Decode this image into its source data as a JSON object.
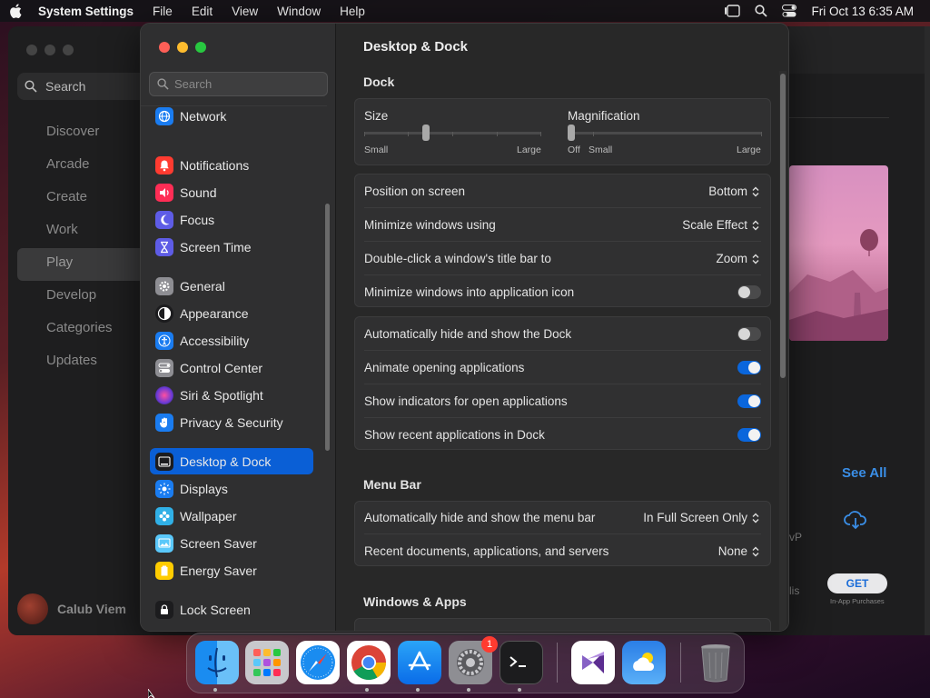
{
  "menubar": {
    "app_name": "System Settings",
    "menus": [
      "File",
      "Edit",
      "View",
      "Window",
      "Help"
    ],
    "clock": "Fri Oct 13  6:35 AM"
  },
  "background_app": {
    "search_label": "Search",
    "nav": [
      "Discover",
      "Arcade",
      "Create",
      "Work",
      "Play",
      "Develop",
      "Categories",
      "Updates"
    ],
    "selected_nav": "Play",
    "user_name": "Calub Viem",
    "see_all": "See All",
    "fragment_vp": "vP",
    "fragment_lis": "lis",
    "get_button": "GET",
    "in_app": "In-App Purchases"
  },
  "sidebar": {
    "search_placeholder": "Search",
    "items": [
      {
        "label": "Network",
        "icon": "network-icon",
        "color": "#1a7cf0"
      },
      {
        "label": "Notifications",
        "icon": "bell-icon",
        "color": "#ff3b30"
      },
      {
        "label": "Sound",
        "icon": "speaker-icon",
        "color": "#ff2d55"
      },
      {
        "label": "Focus",
        "icon": "moon-icon",
        "color": "#5e5ce6"
      },
      {
        "label": "Screen Time",
        "icon": "hourglass-icon",
        "color": "#5e5ce6"
      },
      {
        "label": "General",
        "icon": "gear-icon",
        "color": "#8e8e93"
      },
      {
        "label": "Appearance",
        "icon": "appearance-icon",
        "color": "#1c1c1e"
      },
      {
        "label": "Accessibility",
        "icon": "accessibility-icon",
        "color": "#1a7cf0"
      },
      {
        "label": "Control Center",
        "icon": "control-center-icon",
        "color": "#8e8e93"
      },
      {
        "label": "Siri & Spotlight",
        "icon": "siri-icon",
        "color": "#6a3ad6"
      },
      {
        "label": "Privacy & Security",
        "icon": "hand-icon",
        "color": "#1a7cf0"
      },
      {
        "label": "Desktop & Dock",
        "icon": "dock-icon",
        "color": "#1c1c1e"
      },
      {
        "label": "Displays",
        "icon": "sun-icon",
        "color": "#1a7cf0"
      },
      {
        "label": "Wallpaper",
        "icon": "flower-icon",
        "color": "#30b0e6"
      },
      {
        "label": "Screen Saver",
        "icon": "screensaver-icon",
        "color": "#5ac8fa"
      },
      {
        "label": "Energy Saver",
        "icon": "battery-icon",
        "color": "#ffcc00"
      },
      {
        "label": "Lock Screen",
        "icon": "lock-icon",
        "color": "#1c1c1e"
      }
    ],
    "selected": "Desktop & Dock"
  },
  "content": {
    "title": "Desktop & Dock",
    "dock_section": "Dock",
    "size": {
      "label": "Size",
      "min_label": "Small",
      "max_label": "Large",
      "value": 0.35
    },
    "magnification": {
      "label": "Magnification",
      "off_label": "Off",
      "min_label": "Small",
      "max_label": "Large",
      "value": 0.0
    },
    "dock_rows": [
      {
        "label": "Position on screen",
        "value": "Bottom"
      },
      {
        "label": "Minimize windows using",
        "value": "Scale Effect"
      },
      {
        "label": "Double-click a window's title bar to",
        "value": "Zoom"
      },
      {
        "label": "Minimize windows into application icon",
        "toggle": false
      }
    ],
    "dock_toggles": [
      {
        "label": "Automatically hide and show the Dock",
        "toggle": false
      },
      {
        "label": "Animate opening applications",
        "toggle": true
      },
      {
        "label": "Show indicators for open applications",
        "toggle": true
      },
      {
        "label": "Show recent applications in Dock",
        "toggle": true
      }
    ],
    "menubar_section": "Menu Bar",
    "menubar_rows": [
      {
        "label": "Automatically hide and show the menu bar",
        "value": "In Full Screen Only"
      },
      {
        "label": "Recent documents, applications, and servers",
        "value": "None"
      }
    ],
    "windows_section": "Windows & Apps"
  },
  "dock": {
    "apps": [
      "finder-icon",
      "launchpad-icon",
      "safari-icon",
      "chrome-icon",
      "app-store-icon",
      "system-settings-icon",
      "terminal-icon",
      "visual-studio-icon",
      "weather-icon",
      "trash-icon"
    ],
    "settings_badge": "1"
  }
}
